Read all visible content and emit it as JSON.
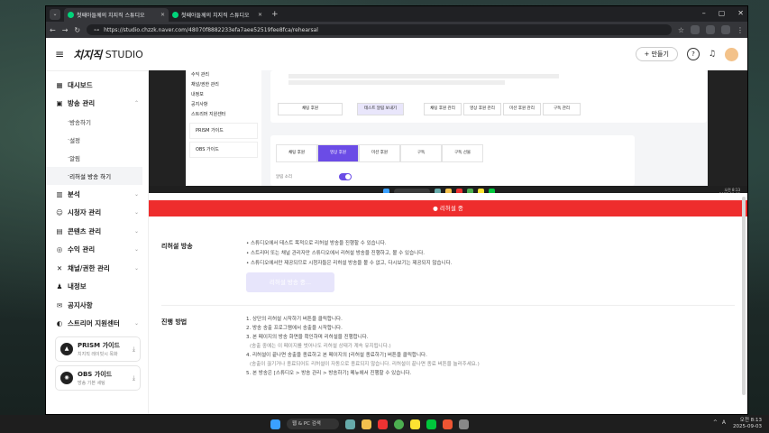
{
  "browser": {
    "tabs": [
      {
        "label": "첫째아들께의 치지직 스튜디오"
      },
      {
        "label": "첫째아들께의 치지직 스튜디오"
      }
    ],
    "url": "https://studio.chzzk.naver.com/48070f8882233efa7aee52519fee8fca/rehearsal"
  },
  "header": {
    "logo": "치지직",
    "studio": "STUDIO",
    "make_button": "+ 만들기"
  },
  "sidebar": {
    "items": [
      {
        "label": "대시보드",
        "icon": "▦"
      },
      {
        "label": "방송 관리",
        "icon": "▣",
        "chev": "⌃"
      },
      {
        "label": "분석",
        "icon": "▥",
        "chev": "⌄"
      },
      {
        "label": "시청자 관리",
        "icon": "☺",
        "chev": "⌄"
      },
      {
        "label": "콘텐츠 관리",
        "icon": "▤",
        "chev": "⌄"
      },
      {
        "label": "수익 관리",
        "icon": "◎",
        "chev": "⌄"
      },
      {
        "label": "채널/권한 관리",
        "icon": "✕",
        "chev": "⌄"
      },
      {
        "label": "내정보",
        "icon": "♟"
      },
      {
        "label": "공지사항",
        "icon": "✉"
      },
      {
        "label": "스트리머 지원센터",
        "icon": "◐",
        "chev": "⌄"
      }
    ],
    "subitems": [
      {
        "label": "방송하기"
      },
      {
        "label": "설정"
      },
      {
        "label": "알림"
      },
      {
        "label": "리허설 방송 하기"
      }
    ],
    "cards": [
      {
        "title": "PRISM 가이드",
        "sub": "치지직 레이빗시 목화"
      },
      {
        "title": "OBS 가이드",
        "sub": "방송 기본 세팅"
      }
    ]
  },
  "preview": {
    "side": [
      "수익 관리",
      "채널/권한 관리",
      "내정보",
      "공지사항",
      "스트리머 지원센터",
      "PRISM 가이드",
      "OBS 가이드"
    ],
    "buttons": [
      "채팅 후원",
      "테스트 알림 보내기",
      "채팅 후원 관리",
      "영상 후원 관리",
      "미션 후원 관리",
      "구독 관리"
    ],
    "tabs": [
      "채팅 후원",
      "영상 후원",
      "미션 후원",
      "구독",
      "구독 선물"
    ],
    "toggle_label": "알림 소리",
    "clock": [
      "오전 8:13",
      "2025-09-03"
    ]
  },
  "banner": {
    "label": "리허설 중"
  },
  "rehearsal": {
    "title": "리허설 방송",
    "bullets": [
      "• 스튜디오에서 테스트 목적으로 리허설 방송을 진행할 수 있습니다.",
      "• 스트리머 또는 채널 관리자만 스튜디오에서 리허설 방송을 진행하고, 볼 수 있습니다.",
      "• 스튜디오에서만 제공되므로 시청자들은 리허설 방송을 볼 수 없고, 다시보기는 제공되지 않습니다."
    ],
    "button": "리허설 방송 중..."
  },
  "method": {
    "title": "진행 방법",
    "steps": [
      "1. 상단의 리허설 시작하기 버튼을 클릭합니다.",
      "2. 방송 송출 프로그램에서 송출을 시작합니다.",
      "3. 본 페이지의 방송 화면을 확인하며 리허설을 진행합니다.",
      "(송출 중에는 이 페이지를 벗어나도 리허설 상태가 계속 유지됩니다.)",
      "4. 리허설이 끝나면 송출을 종료하고 본 페이지의 [리허설 종료하기] 버튼을 클릭합니다.",
      "(송출이 끊기거나 종료되어도 리허설이 자동으로 종료되지 않습니다. 리허설이 끝나면 종료 버튼을 눌러주세요.)",
      "5. 본 방송은 [스튜디오 > 방송 관리 > 방송하기] 메뉴에서 진행할 수 있습니다."
    ]
  },
  "taskbar": {
    "search": "웹 & PC 검색",
    "time": "오전 8:13",
    "date": "2025-09-03",
    "tray": [
      "^",
      "A"
    ]
  }
}
